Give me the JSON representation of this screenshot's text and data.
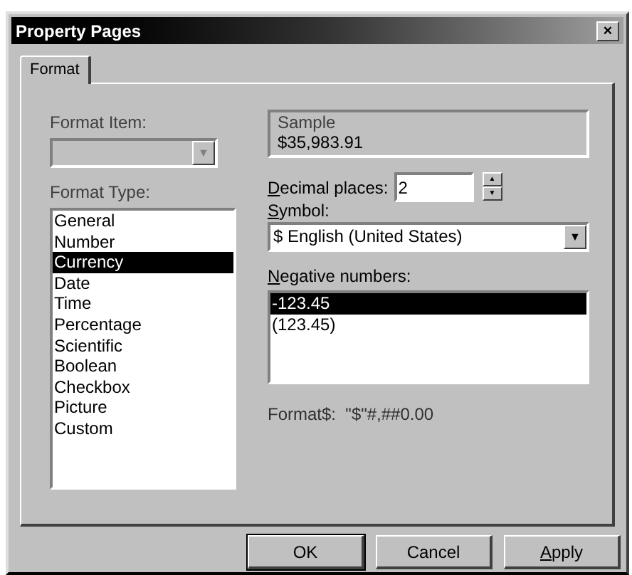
{
  "window": {
    "title": "Property Pages",
    "close": "×"
  },
  "tabs": [
    {
      "label": "Format",
      "selected": true
    }
  ],
  "format_item": {
    "label": "Format Item:",
    "disabled": true,
    "arrow": "▼"
  },
  "format_type": {
    "label": "Format Type:",
    "items": [
      {
        "text": "General",
        "selected": false
      },
      {
        "text": "Number",
        "selected": false
      },
      {
        "text": "Currency",
        "selected": true
      },
      {
        "text": "Date",
        "selected": false
      },
      {
        "text": "Time",
        "selected": false
      },
      {
        "text": "Percentage",
        "selected": false
      },
      {
        "text": "Scientific",
        "selected": false
      },
      {
        "text": "Boolean",
        "selected": false
      },
      {
        "text": "Checkbox",
        "selected": false
      },
      {
        "text": "Picture",
        "selected": false
      },
      {
        "text": "Custom",
        "selected": false
      }
    ]
  },
  "sample": {
    "label": "Sample",
    "value": "$35,983.91"
  },
  "decimal_places": {
    "mnemonic": "D",
    "rest": "ecimal places:",
    "value": "2",
    "up": "▲",
    "down": "▼"
  },
  "symbol": {
    "mnemonic": "S",
    "rest": "ymbol:",
    "value": "$ English (United States)",
    "arrow": "▼"
  },
  "negative_numbers": {
    "mnemonic": "N",
    "rest": "egative numbers:",
    "items": [
      {
        "text": "-123.45",
        "selected": true
      },
      {
        "text": "(123.45)",
        "selected": false
      }
    ]
  },
  "format_string": "Format$:  \"$\"#,##0.00",
  "buttons": [
    {
      "rest": "OK"
    },
    {
      "rest": "Cancel"
    },
    {
      "mnemonic": "A",
      "rest": "pply"
    }
  ]
}
